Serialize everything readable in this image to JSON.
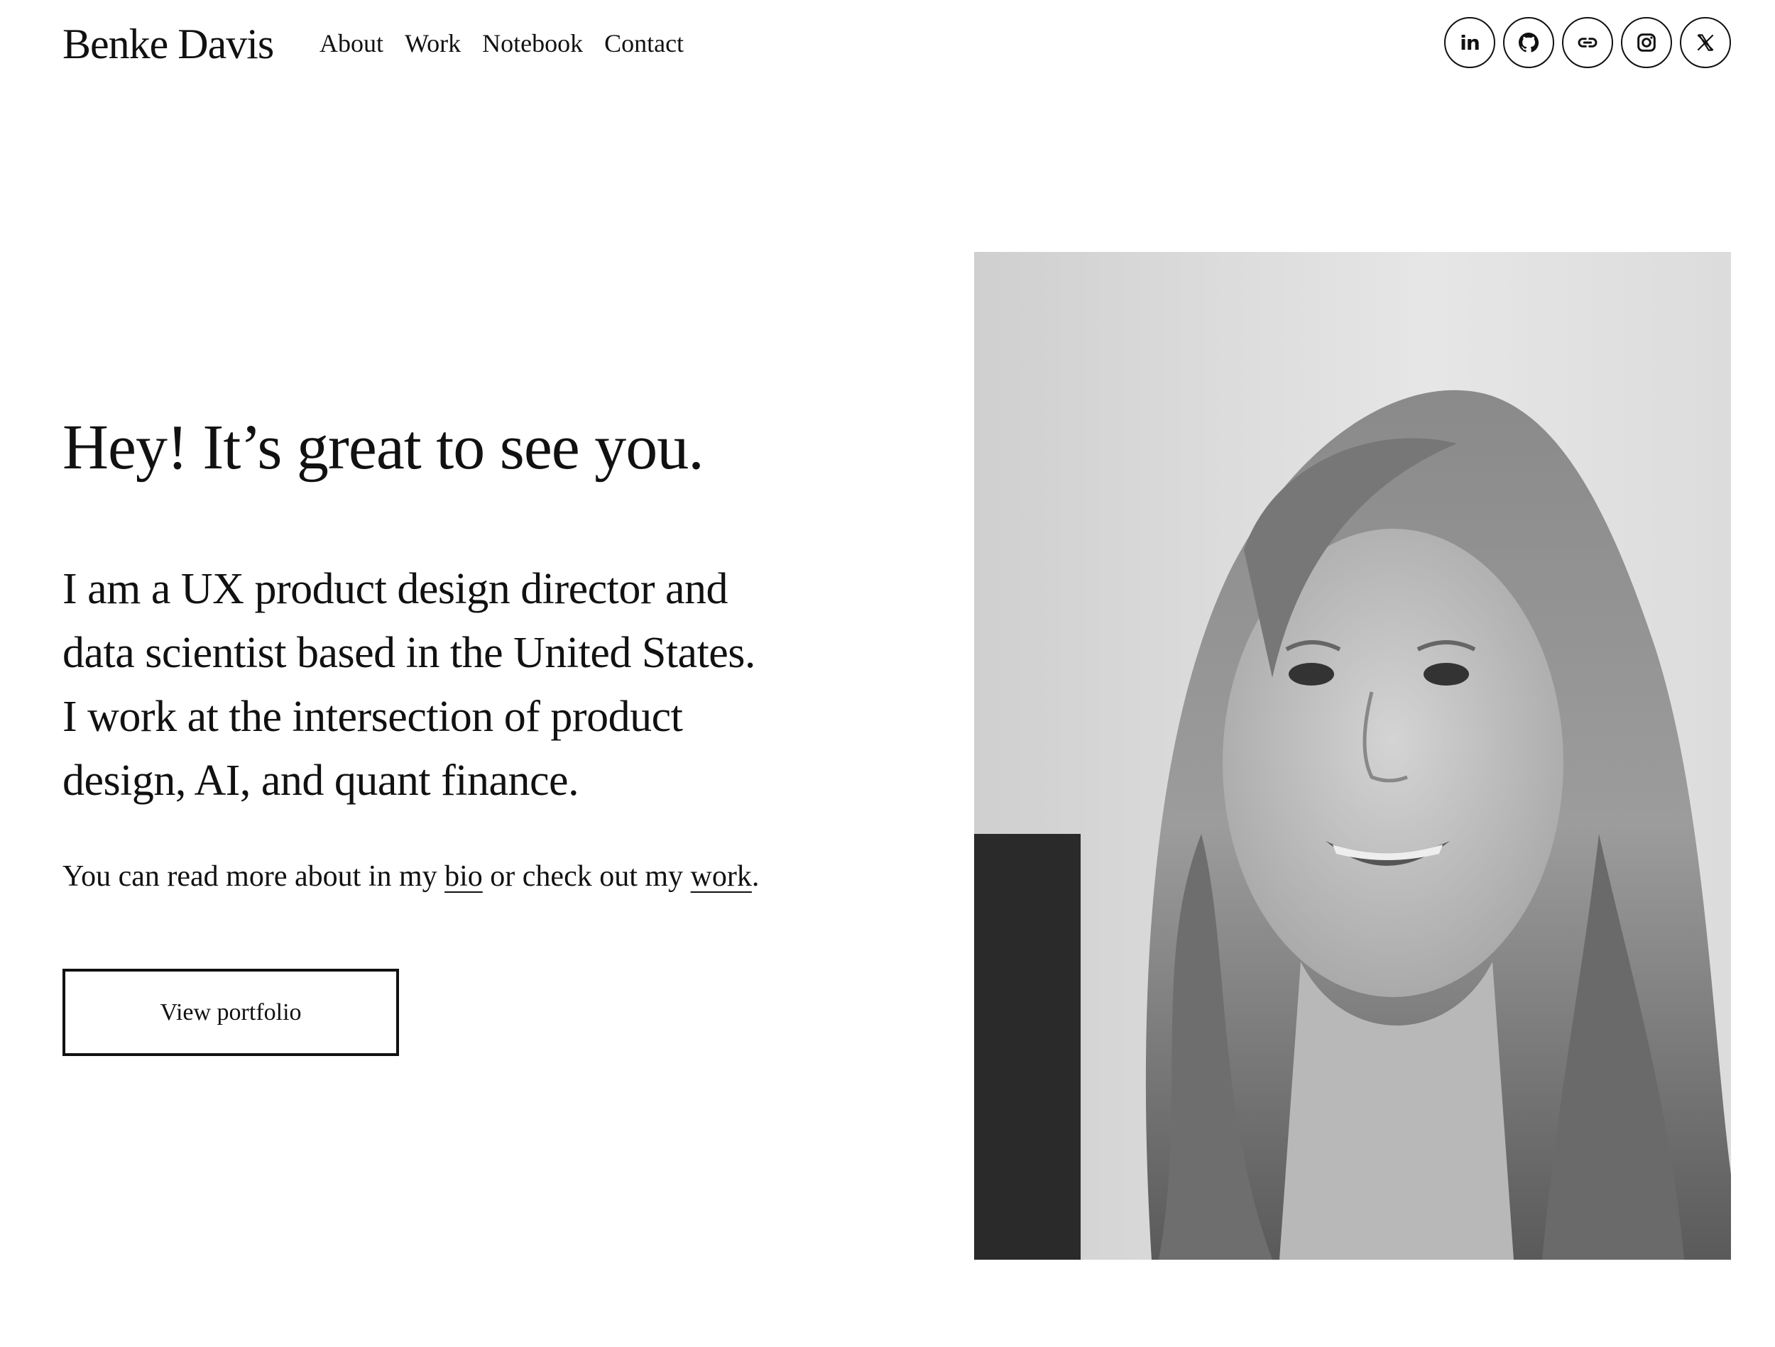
{
  "header": {
    "brand": "Benke Davis",
    "nav": [
      {
        "label": "About"
      },
      {
        "label": "Work"
      },
      {
        "label": "Notebook"
      },
      {
        "label": "Contact"
      }
    ],
    "socials": [
      {
        "name": "linkedin",
        "icon": "linkedin-icon"
      },
      {
        "name": "github",
        "icon": "github-icon"
      },
      {
        "name": "link",
        "icon": "link-icon"
      },
      {
        "name": "instagram",
        "icon": "instagram-icon"
      },
      {
        "name": "x",
        "icon": "x-icon"
      }
    ]
  },
  "hero": {
    "heading": "Hey! It’s great to see you.",
    "intro_lines": [
      "I am a UX product design director and",
      "data scientist based in the United States.",
      "I work at the intersection of product",
      "design, AI, and quant finance."
    ],
    "more_prefix": "You can read more about in my ",
    "bio_link": "bio",
    "more_middle": " or check out my ",
    "work_link": "work",
    "more_suffix": ".",
    "button_label": "View portfolio"
  },
  "photo": {
    "description_icon": "portrait-photo"
  },
  "colors": {
    "text": "#111111",
    "background": "#ffffff"
  }
}
